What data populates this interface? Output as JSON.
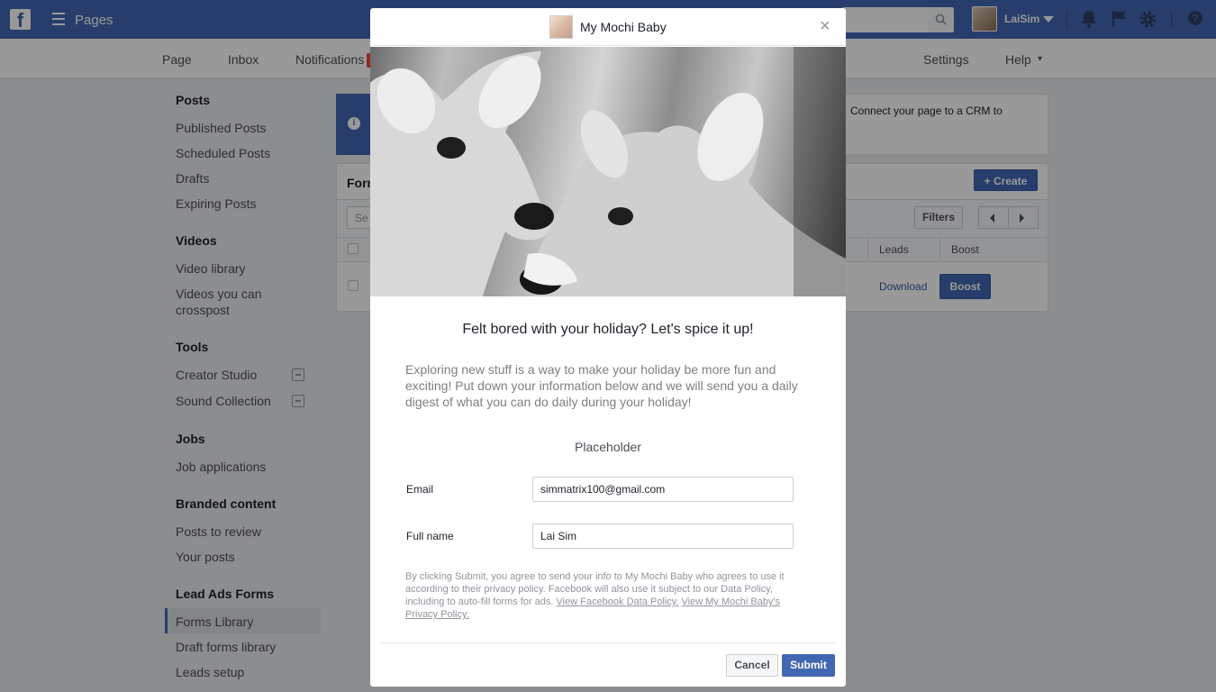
{
  "topbar": {
    "title": "Pages",
    "user_name": "LaiSim",
    "logo_letter": "f"
  },
  "pagenav": {
    "items": [
      "Page",
      "Inbox",
      "Notifications"
    ],
    "right_items": [
      "Settings",
      "Help"
    ],
    "help_caret": "▾"
  },
  "sidebar": {
    "sections": [
      {
        "heading": "Posts",
        "items": [
          "Published Posts",
          "Scheduled Posts",
          "Drafts",
          "Expiring Posts"
        ]
      },
      {
        "heading": "Videos",
        "items": [
          "Video library",
          "Videos you can crosspost"
        ]
      },
      {
        "heading": "Tools",
        "items": [
          "Creator Studio",
          "Sound Collection"
        ]
      },
      {
        "heading": "Jobs",
        "items": [
          "Job applications"
        ]
      },
      {
        "heading": "Branded content",
        "items": [
          "Posts to review",
          "Your posts"
        ]
      },
      {
        "heading": "Lead Ads Forms",
        "items": [
          "Forms Library",
          "Draft forms library",
          "Leads setup"
        ]
      }
    ],
    "active_item": "Forms Library"
  },
  "main": {
    "info_text": "Connect your page to a CRM to",
    "info_icon": "i",
    "forms_title": "Forms",
    "create_label": "+ Create",
    "search_placeholder": "Se",
    "filters_label": "Filters",
    "columns": [
      "Leads",
      "Boost"
    ],
    "download_label": "Download",
    "boost_label": "Boost"
  },
  "modal": {
    "page_name": "My Mochi Baby",
    "close_symbol": "×",
    "heading": "Felt bored with your holiday? Let's spice it up!",
    "description": "Exploring new stuff is a way to make your holiday be more fun and exciting! Put down your information below and we will send you a daily digest of what you can do daily during your holiday!",
    "placeholder_label": "Placeholder",
    "fields": [
      {
        "label": "Email",
        "value": "simmatrix100@gmail.com"
      },
      {
        "label": "Full name",
        "value": "Lai Sim"
      }
    ],
    "disclaimer_text": "By clicking Submit, you agree to send your info to My Mochi Baby who agrees to use it according to their privacy policy. Facebook will also use it subject to our Data Policy, including to auto-fill forms for ads. ",
    "disclaimer_link1": "View Facebook Data Policy.",
    "disclaimer_link2": "View My Mochi Baby's Privacy Policy.",
    "cancel_label": "Cancel",
    "submit_label": "Submit"
  },
  "colors": {
    "brand_blue": "#4267b2",
    "overlay": "rgba(0,0,0,0.4)"
  }
}
